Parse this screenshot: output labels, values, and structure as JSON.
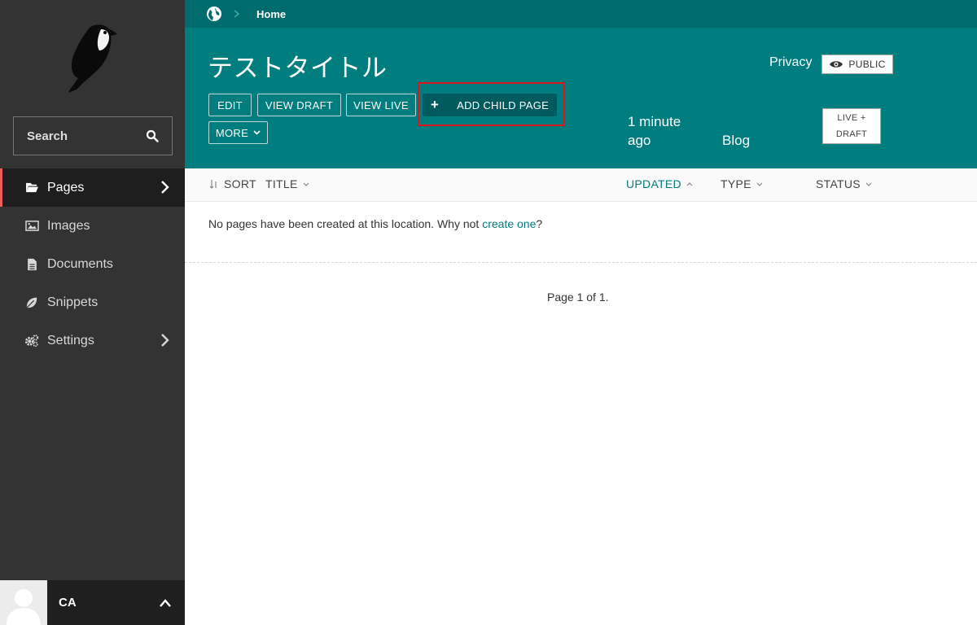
{
  "sidebar": {
    "search_label": "Search",
    "items": [
      {
        "label": "Pages",
        "icon": "folder-open-icon"
      },
      {
        "label": "Images",
        "icon": "image-icon"
      },
      {
        "label": "Documents",
        "icon": "document-icon"
      },
      {
        "label": "Snippets",
        "icon": "leaf-icon"
      },
      {
        "label": "Settings",
        "icon": "cogs-icon"
      }
    ],
    "user_initials": "CA"
  },
  "header": {
    "breadcrumb_home": "Home",
    "title": "テストタイトル",
    "buttons": {
      "edit": "EDIT",
      "view_draft": "VIEW DRAFT",
      "view_live": "VIEW LIVE",
      "add_child": "ADD CHILD PAGE",
      "add_child_plus": "+",
      "more": "MORE"
    },
    "updated_line1": "1 minute",
    "updated_line2": "ago",
    "type": "Blog",
    "privacy_label": "Privacy",
    "privacy_badge": "PUBLIC",
    "status_line1": "LIVE +",
    "status_line2": "DRAFT"
  },
  "listing": {
    "sort": "SORT",
    "title": "TITLE",
    "updated": "UPDATED",
    "type": "TYPE",
    "status": "STATUS",
    "empty_message": "No pages have been created at this location. Why not ",
    "create_link": "create one",
    "empty_suffix": "?",
    "pagination": "Page 1 of 1."
  },
  "colors": {
    "teal": "#007d7e",
    "teal_dark": "#006b6c",
    "sidebar_bg": "#333333",
    "active_indicator": "#e9605a",
    "highlight": "#e0151c"
  }
}
